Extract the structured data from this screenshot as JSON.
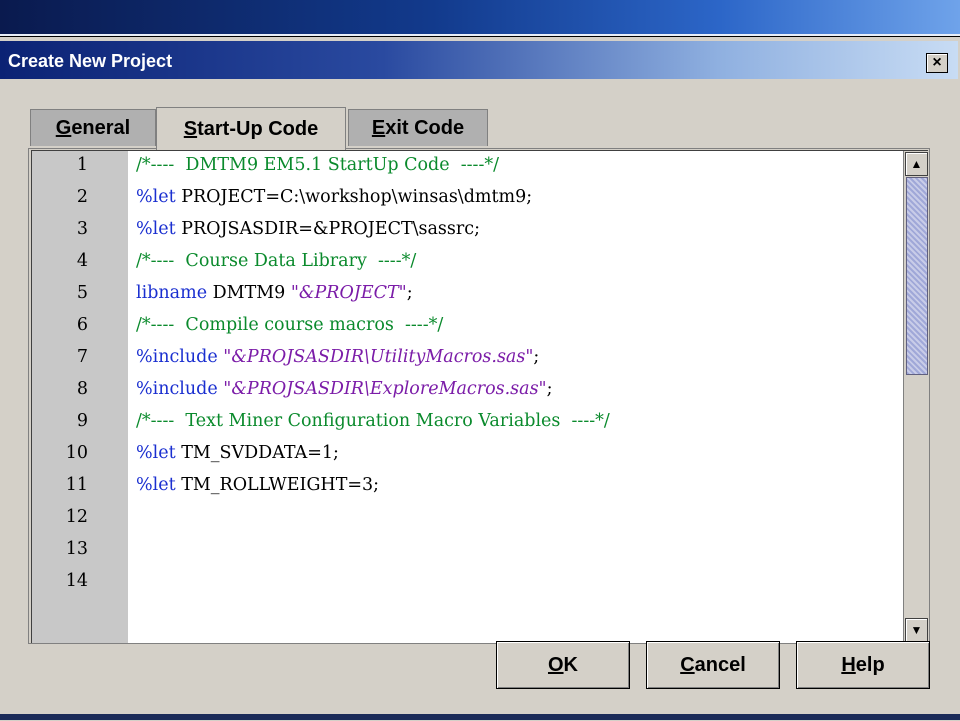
{
  "dialog": {
    "title": "Create New Project",
    "close_label": "×"
  },
  "tabs": [
    {
      "label_u": "G",
      "label_rest": "eneral"
    },
    {
      "label_u": "S",
      "label_rest": "tart-Up Code"
    },
    {
      "label_u": "E",
      "label_rest": "xit Code"
    }
  ],
  "editor": {
    "lines": [
      {
        "num": "1",
        "parts": [
          {
            "t": "/*----  DMTM9 EM5.1 StartUp Code  ----*/",
            "c": "comment"
          }
        ]
      },
      {
        "num": "2",
        "parts": [
          {
            "t": "%let ",
            "c": "kw"
          },
          {
            "t": "PROJECT=C:\\workshop\\winsas\\dmtm9;",
            "c": "plain"
          }
        ]
      },
      {
        "num": "3",
        "parts": [
          {
            "t": "%let ",
            "c": "kw"
          },
          {
            "t": "PROJSASDIR=&PROJECT\\sassrc;",
            "c": "plain"
          }
        ]
      },
      {
        "num": "4",
        "parts": [
          {
            "t": "/*----  Course Data Library  ----*/",
            "c": "comment"
          }
        ]
      },
      {
        "num": "5",
        "parts": [
          {
            "t": "libname ",
            "c": "kw"
          },
          {
            "t": "DMTM9 ",
            "c": "plain"
          },
          {
            "t": "\"&PROJECT\"",
            "c": "str"
          },
          {
            "t": ";",
            "c": "plain"
          }
        ]
      },
      {
        "num": "6",
        "parts": [
          {
            "t": "/*----  Compile course macros  ----*/",
            "c": "comment"
          }
        ]
      },
      {
        "num": "7",
        "parts": [
          {
            "t": "%include ",
            "c": "kw"
          },
          {
            "t": "\"&PROJSASDIR\\UtilityMacros.sas\"",
            "c": "str"
          },
          {
            "t": ";",
            "c": "plain"
          }
        ]
      },
      {
        "num": "8",
        "parts": [
          {
            "t": "%include ",
            "c": "kw"
          },
          {
            "t": "\"&PROJSASDIR\\ExploreMacros.sas\"",
            "c": "str"
          },
          {
            "t": ";",
            "c": "plain"
          }
        ]
      },
      {
        "num": "9",
        "parts": [
          {
            "t": "/*----  Text Miner Configuration Macro Variables  ----*/",
            "c": "comment"
          }
        ]
      },
      {
        "num": "10",
        "parts": [
          {
            "t": "%let ",
            "c": "kw"
          },
          {
            "t": "TM_SVDDATA=1;",
            "c": "plain"
          }
        ]
      },
      {
        "num": "11",
        "parts": [
          {
            "t": "%let ",
            "c": "kw"
          },
          {
            "t": "TM_ROLLWEIGHT=3;",
            "c": "plain"
          }
        ]
      },
      {
        "num": "12",
        "parts": []
      },
      {
        "num": "13",
        "parts": []
      },
      {
        "num": "14",
        "parts": []
      }
    ]
  },
  "buttons": {
    "ok": {
      "u": "O",
      "rest": "K"
    },
    "cancel": {
      "u": "C",
      "rest": "ancel"
    },
    "help": {
      "u": "H",
      "rest": "elp"
    }
  },
  "colors": {
    "comment": "#0a8a2c",
    "keyword": "#1a2fd0",
    "string": "#7b1ca8",
    "titlebar": "#0b2274"
  },
  "icons": {
    "close": "close-icon",
    "scroll_up": "scroll-up-arrow-icon",
    "scroll_down": "scroll-down-arrow-icon"
  }
}
